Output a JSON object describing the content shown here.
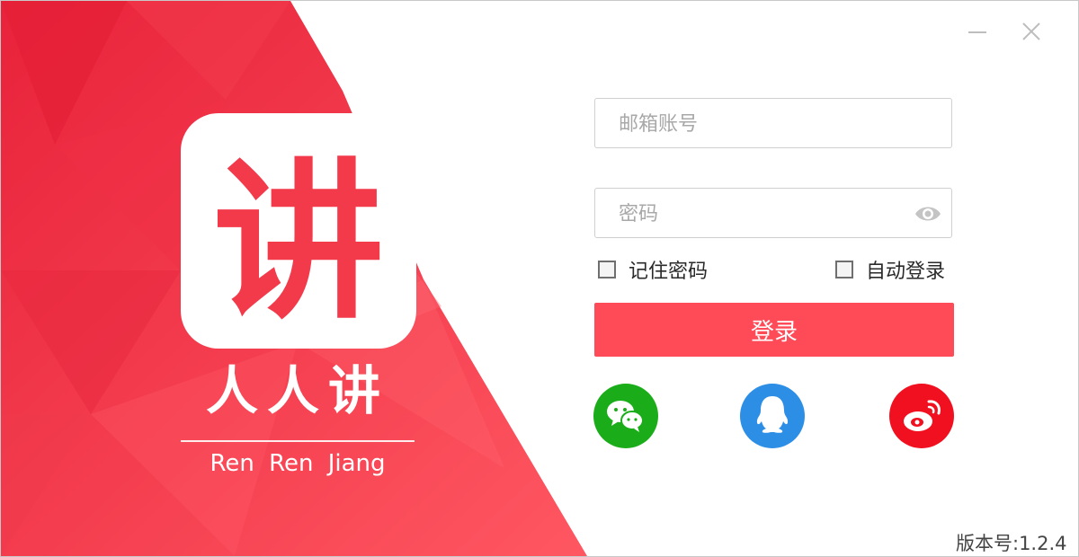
{
  "brand": {
    "logo_char": "讲",
    "name": "人人讲",
    "name_en": "Ren Ren Jiang",
    "color": "#f23a4b"
  },
  "window_controls": {
    "minimize_icon": "minimize-icon",
    "close_icon": "close-icon"
  },
  "form": {
    "email_placeholder": "邮箱账号",
    "email_value": "",
    "password_placeholder": "密码",
    "password_value": "",
    "remember_label": "记住密码",
    "remember_checked": false,
    "auto_login_label": "自动登录",
    "auto_login_checked": false,
    "login_label": "登录",
    "login_color": "#ff4b58"
  },
  "social": [
    {
      "name": "wechat",
      "icon": "wechat-icon",
      "color": "#1aad19"
    },
    {
      "name": "qq",
      "icon": "qq-icon",
      "color": "#2d8ee6"
    },
    {
      "name": "weibo",
      "icon": "weibo-icon",
      "color": "#f0101f"
    }
  ],
  "version": "版本号:1.2.4"
}
